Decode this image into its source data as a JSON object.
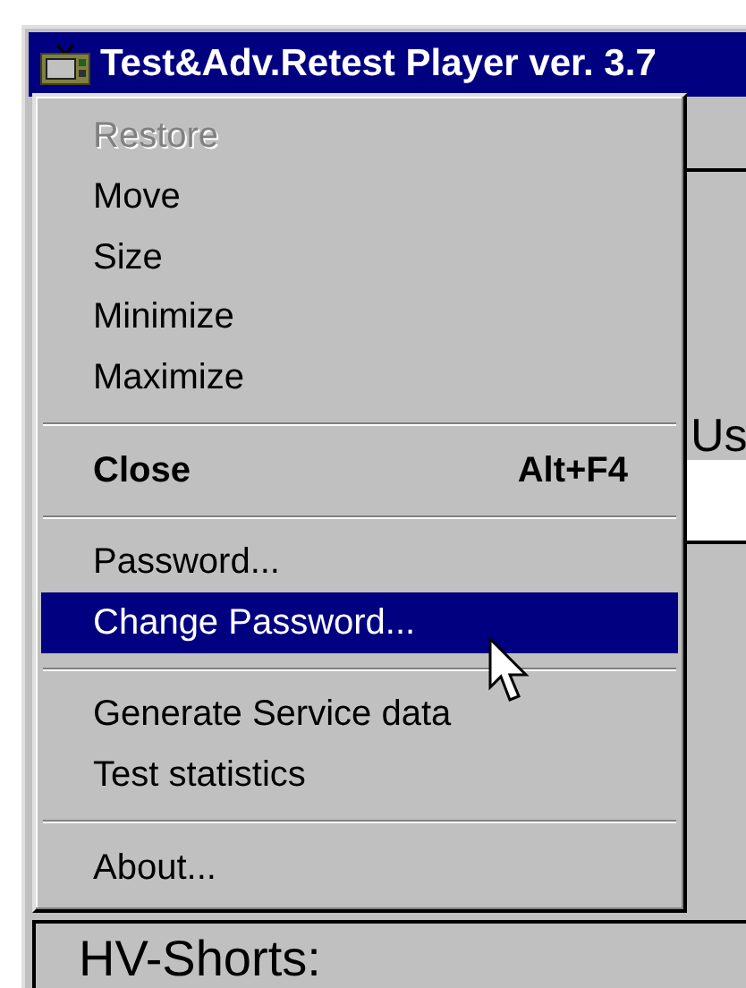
{
  "window": {
    "title": "Test&Adv.Retest Player ver. 3.7"
  },
  "background": {
    "label": "Us",
    "section_label": "HV-Shorts:"
  },
  "system_menu": {
    "items": [
      {
        "kind": "item",
        "label": "Restore",
        "disabled": true,
        "selected": false
      },
      {
        "kind": "item",
        "label": "Move",
        "disabled": false,
        "selected": false
      },
      {
        "kind": "item",
        "label": "Size",
        "disabled": false,
        "selected": false
      },
      {
        "kind": "item",
        "label": "Minimize",
        "disabled": false,
        "selected": false
      },
      {
        "kind": "item",
        "label": "Maximize",
        "disabled": false,
        "selected": false
      },
      {
        "kind": "separator"
      },
      {
        "kind": "item",
        "label": "Close",
        "shortcut": "Alt+F4",
        "bold": true,
        "disabled": false,
        "selected": false
      },
      {
        "kind": "separator"
      },
      {
        "kind": "item",
        "label": "Password...",
        "disabled": false,
        "selected": false
      },
      {
        "kind": "item",
        "label": "Change Password...",
        "disabled": false,
        "selected": true
      },
      {
        "kind": "separator"
      },
      {
        "kind": "item",
        "label": "Generate Service data",
        "disabled": false,
        "selected": false
      },
      {
        "kind": "item",
        "label": "Test statistics",
        "disabled": false,
        "selected": false
      },
      {
        "kind": "separator"
      },
      {
        "kind": "item",
        "label": "About...",
        "disabled": false,
        "selected": false
      }
    ]
  }
}
